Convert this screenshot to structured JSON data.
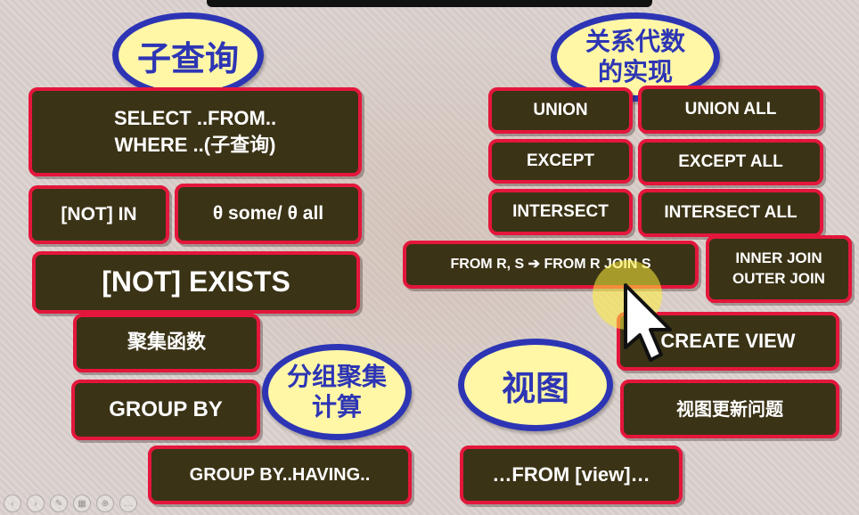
{
  "ellipses": {
    "subquery": "子查询",
    "relalg_line1": "关系代数",
    "relalg_line2": "的实现",
    "groupcalc_line1": "分组聚集",
    "groupcalc_line2": "计算",
    "view": "视图"
  },
  "left": {
    "select_line1": "SELECT ..FROM..",
    "select_line2_prefix": "WHERE ..(",
    "select_line2_zh": "子查询",
    "select_line2_suffix": ")",
    "not_in": "[NOT] IN",
    "some_all": "θ some/ θ all",
    "not_exists": "[NOT] EXISTS",
    "aggregate": "聚集函数",
    "group_by": "GROUP BY",
    "group_by_having": "GROUP BY..HAVING.."
  },
  "right": {
    "union": "UNION",
    "union_all": "UNION ALL",
    "except": "EXCEPT",
    "except_all": "EXCEPT ALL",
    "intersect": "INTERSECT",
    "intersect_all": "INTERSECT ALL",
    "from_join": "FROM R, S  ➔ FROM R JOIN S",
    "inner_join": "INNER JOIN",
    "outer_join": "OUTER JOIN",
    "create_view": "CREATE VIEW",
    "view_update": "视图更新问题",
    "from_view": "…FROM [view]…"
  },
  "colors": {
    "box_fill": "#3b3316",
    "box_border": "#e4163b",
    "ellipse_fill": "#fff7a6",
    "ellipse_border": "#2d35b5",
    "ellipse_text": "#2d35b5"
  },
  "icons": [
    "mouse-pointer-icon",
    "pointer-highlight",
    "player-controls"
  ]
}
